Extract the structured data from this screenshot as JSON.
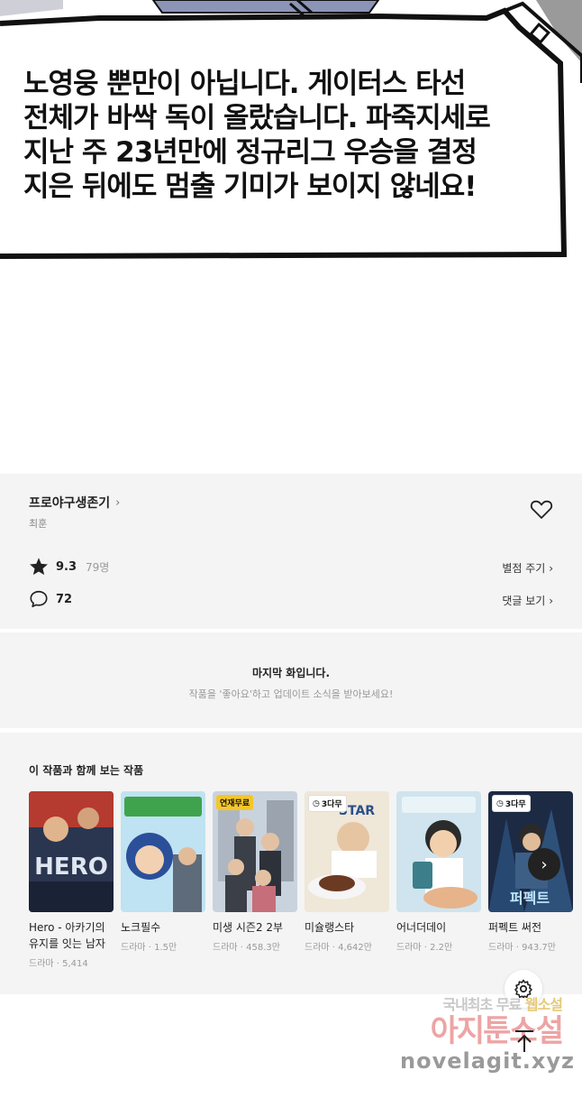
{
  "comic": {
    "speech_text": "노영웅 뿐만이 아닙니다. 게이터스 타선\n전체가 바싹 독이 올랐습니다. 파죽지세로\n지난 주 23년만에 정규리그 우승을 결정\n지은 뒤에도 멈출 기미가 보이지 않네요!"
  },
  "series": {
    "title": "프로야구생존기",
    "author": "최훈",
    "rating": "9.3",
    "rating_count": "79명",
    "comment_count": "72",
    "rate_link": "별점 주기",
    "comments_link": "댓글 보기"
  },
  "last_episode": {
    "title": "마지막 화입니다.",
    "subtitle": "작품을 '좋아요'하고 업데이트 소식을 받아보세요!"
  },
  "recommendations": {
    "heading": "이 작품과 함께 보는 작품",
    "items": [
      {
        "title": "Hero - 아카기의 유지를 잇는 남자",
        "meta": "드라마 · 5,414",
        "badge": "",
        "color": "#2a3550"
      },
      {
        "title": "노크필수",
        "meta": "드라마 · 1.5만",
        "badge": "",
        "color": "#6fb2d8"
      },
      {
        "title": "미생 시즌2 2부",
        "meta": "드라마 · 458.3만",
        "badge": "연재무료",
        "color": "#9aa3ae"
      },
      {
        "title": "미슐랭스타",
        "meta": "드라마 · 4,642만",
        "badge": "3다무",
        "color": "#d8c7a8"
      },
      {
        "title": "어너더데이",
        "meta": "드라마 · 2.2만",
        "badge": "",
        "color": "#d9a87a"
      },
      {
        "title": "퍼펙트 써전",
        "meta": "드라마 · 943.7만",
        "badge": "3다무",
        "color": "#1d2a44"
      }
    ]
  },
  "watermark": {
    "line1_a": "국내최초 무료",
    "line1_b": "웹소설",
    "line2": "아지툰소설",
    "line3": "novelagit.xyz"
  },
  "colors": {
    "section_bg": "#f4f4f4",
    "free_badge": "#f6c628"
  }
}
